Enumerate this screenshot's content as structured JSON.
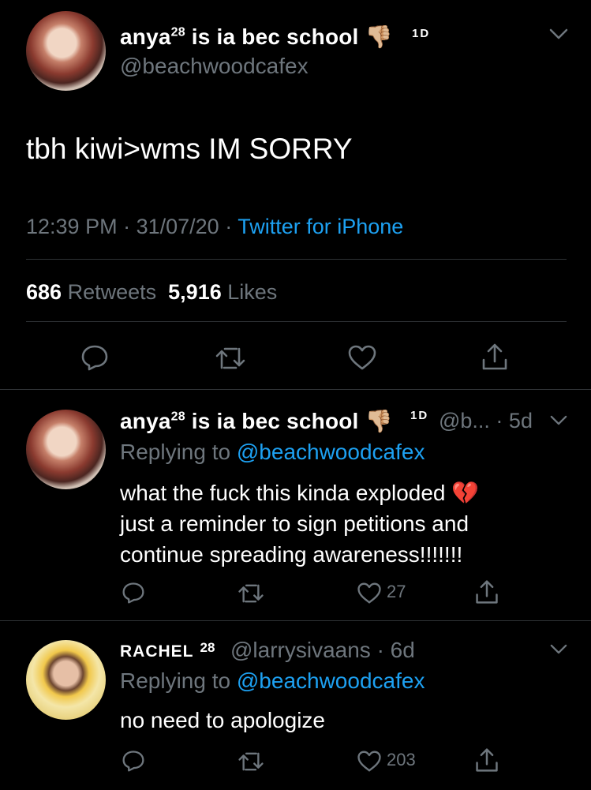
{
  "main_tweet": {
    "display_name": "anya",
    "name_sup": "28",
    "name_rest": " is ia bec school ",
    "emoji": "👎🏼",
    "badge": "1D",
    "handle": "@beachwoodcafex",
    "text": "tbh kiwi>wms IM SORRY",
    "time": "12:39 PM",
    "date": "31/07/20",
    "source": "Twitter for iPhone",
    "retweets_count": "686",
    "retweets_label": "Retweets",
    "likes_count": "5,916",
    "likes_label": "Likes"
  },
  "replies": [
    {
      "display_name": "anya",
      "name_sup": "28",
      "name_rest": " is ia bec school ",
      "emoji": "👎🏼",
      "badge": "1D",
      "handle_time": "@b... · 5d",
      "replying_label": "Replying to ",
      "replying_handle": "@beachwoodcafex",
      "text_line1": "what the fuck this kinda exploded 💔",
      "text_line2": "just a reminder to sign petitions and",
      "text_line3": "continue spreading awareness!!!!!!!",
      "likes": "27"
    },
    {
      "display_name": "RACHEL",
      "name_sup": "28",
      "handle_time": "@larrysivaans · 6d",
      "replying_label": "Replying to ",
      "replying_handle": "@beachwoodcafex",
      "text": "no need to apologize",
      "likes": "203"
    }
  ],
  "colors": {
    "background": "#000000",
    "muted": "#6e767d",
    "link": "#1da1f2",
    "divider": "#2f3336"
  }
}
